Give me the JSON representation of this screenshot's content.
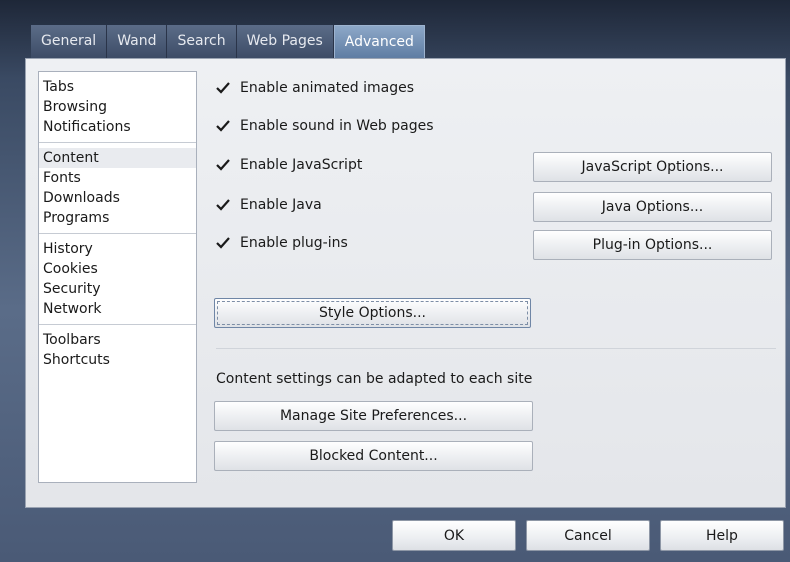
{
  "tabs": [
    {
      "label": "General"
    },
    {
      "label": "Wand"
    },
    {
      "label": "Search"
    },
    {
      "label": "Web Pages"
    },
    {
      "label": "Advanced",
      "active": true
    }
  ],
  "sidebar": {
    "groups": [
      [
        "Tabs",
        "Browsing",
        "Notifications"
      ],
      [
        "Content",
        "Fonts",
        "Downloads",
        "Programs"
      ],
      [
        "History",
        "Cookies",
        "Security",
        "Network"
      ],
      [
        "Toolbars",
        "Shortcuts"
      ]
    ],
    "selected": "Content"
  },
  "options": {
    "animated_images": {
      "label": "Enable animated images",
      "checked": true
    },
    "sound": {
      "label": "Enable sound in Web pages",
      "checked": true
    },
    "javascript": {
      "label": "Enable JavaScript",
      "checked": true
    },
    "java": {
      "label": "Enable Java",
      "checked": true
    },
    "plugins": {
      "label": "Enable plug-ins",
      "checked": true
    }
  },
  "buttons": {
    "javascript_options": "JavaScript Options...",
    "java_options": "Java Options...",
    "plugin_options": "Plug-in Options...",
    "style_options": "Style Options...",
    "manage_site_prefs": "Manage Site Preferences...",
    "blocked_content": "Blocked Content..."
  },
  "info_text": "Content settings can be adapted to each site",
  "footer": {
    "ok": "OK",
    "cancel": "Cancel",
    "help": "Help"
  }
}
